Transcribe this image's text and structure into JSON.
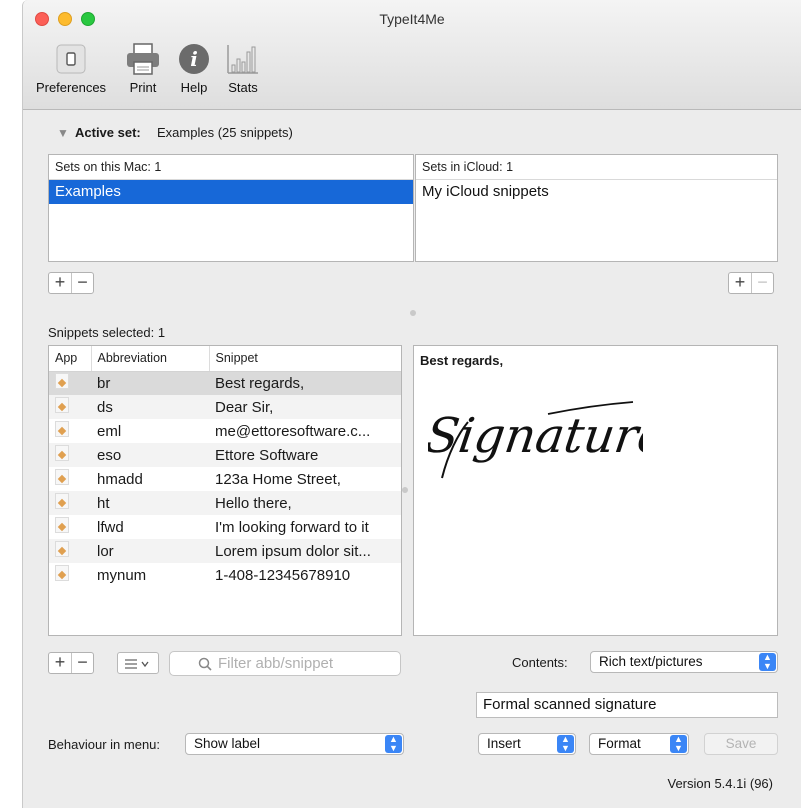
{
  "window": {
    "title": "TypeIt4Me"
  },
  "toolbar": {
    "preferences": "Preferences",
    "print": "Print",
    "help": "Help",
    "stats": "Stats"
  },
  "active_set": {
    "label": "Active set:",
    "value": "Examples (25 snippets)"
  },
  "sets_mac": {
    "header": "Sets on this Mac: 1",
    "items": [
      "Examples"
    ],
    "selected": "Examples"
  },
  "sets_icloud": {
    "header": "Sets in iCloud: 1",
    "items": [
      "My iCloud snippets"
    ]
  },
  "snippets": {
    "selected_label": "Snippets selected: 1",
    "columns": [
      "App",
      "Abbreviation",
      "Snippet"
    ],
    "rows": [
      {
        "abbr": "br",
        "snippet": "Best regards,"
      },
      {
        "abbr": "ds",
        "snippet": "Dear Sir,"
      },
      {
        "abbr": "eml",
        "snippet": "me@ettoresoftware.c..."
      },
      {
        "abbr": "eso",
        "snippet": "Ettore Software"
      },
      {
        "abbr": "hmadd",
        "snippet": "123a Home Street,"
      },
      {
        "abbr": "ht",
        "snippet": "Hello there,"
      },
      {
        "abbr": "lfwd",
        "snippet": "I'm looking forward to it"
      },
      {
        "abbr": "lor",
        "snippet": "Lorem ipsum dolor sit..."
      },
      {
        "abbr": "mynum",
        "snippet": "1-408-12345678910"
      }
    ]
  },
  "preview": {
    "text": "Best regards,",
    "signature": "Signature"
  },
  "filter": {
    "placeholder": "Filter abb/snippet"
  },
  "contents": {
    "label": "Contents:",
    "value": "Rich text/pictures"
  },
  "label_field": {
    "value": "Formal scanned signature"
  },
  "behaviour": {
    "label": "Behaviour in menu:",
    "value": "Show label"
  },
  "insert_popup": "Insert",
  "format_popup": "Format",
  "save_button": "Save",
  "version": "Version 5.4.1i (96)",
  "colors": {
    "selection": "#1768d8",
    "accent": "#3b86f6"
  }
}
